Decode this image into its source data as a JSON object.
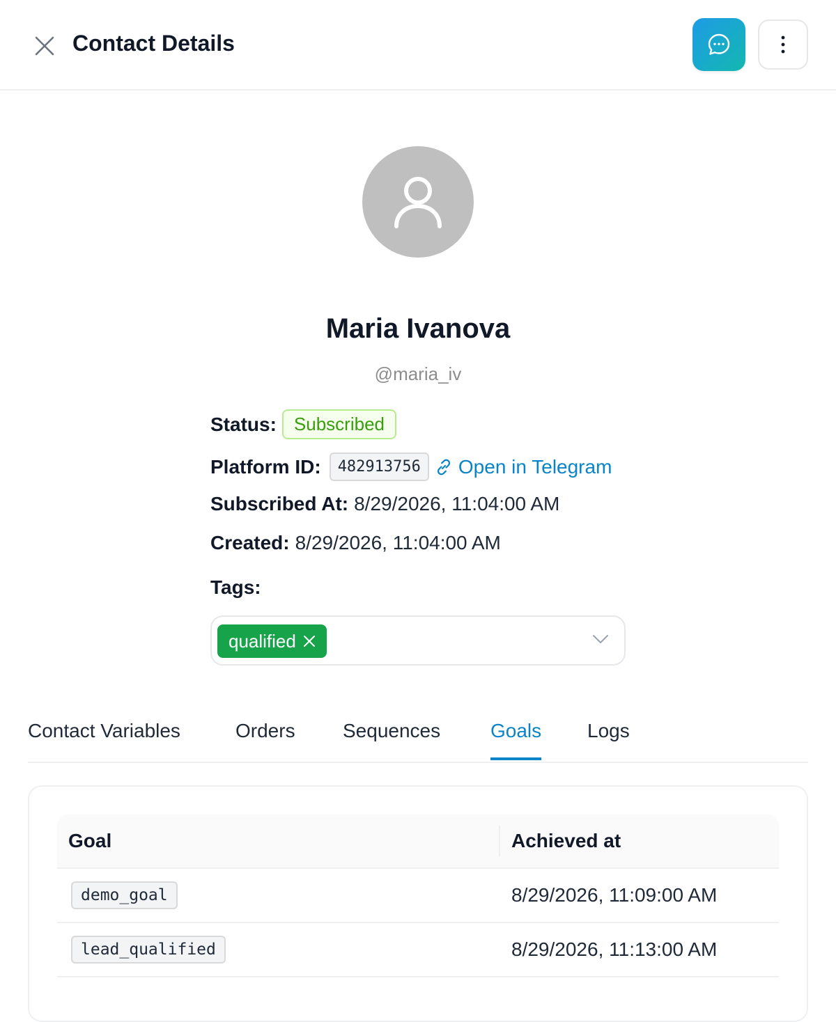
{
  "header": {
    "title": "Contact Details",
    "icons": {
      "close": "close-icon",
      "chat": "chat-bubble-icon",
      "more": "more-vertical-icon"
    }
  },
  "colors": {
    "accent": "#0a84c8",
    "chat_gradient_start": "#1e9be6",
    "chat_gradient_end": "#13b8b0",
    "status_green": "#389e0d",
    "tag_green": "#16a34a",
    "avatar_gray": "#bfbfbf"
  },
  "contact": {
    "name": "Maria Ivanova",
    "username": "@maria_iv",
    "status_label": "Status:",
    "status_value": "Subscribed",
    "platform_id_label": "Platform ID:",
    "platform_id_value": "482913756",
    "telegram_link": "Open in Telegram",
    "subscribed_at_label": "Subscribed At:",
    "subscribed_at_value": "8/29/2026, 11:04:00 AM",
    "created_label": "Created:",
    "created_value": "8/29/2026, 11:04:00 AM",
    "tags_label": "Tags:",
    "tags": [
      "qualified"
    ]
  },
  "tabs": [
    {
      "label": "Contact Variables",
      "active": false
    },
    {
      "label": "Orders",
      "active": false
    },
    {
      "label": "Sequences",
      "active": false
    },
    {
      "label": "Goals",
      "active": true
    },
    {
      "label": "Logs",
      "active": false
    }
  ],
  "goals_table": {
    "columns": [
      "Goal",
      "Achieved at"
    ],
    "rows": [
      {
        "goal": "demo_goal",
        "achieved_at": "8/29/2026, 11:09:00 AM"
      },
      {
        "goal": "lead_qualified",
        "achieved_at": "8/29/2026, 11:13:00 AM"
      }
    ]
  }
}
